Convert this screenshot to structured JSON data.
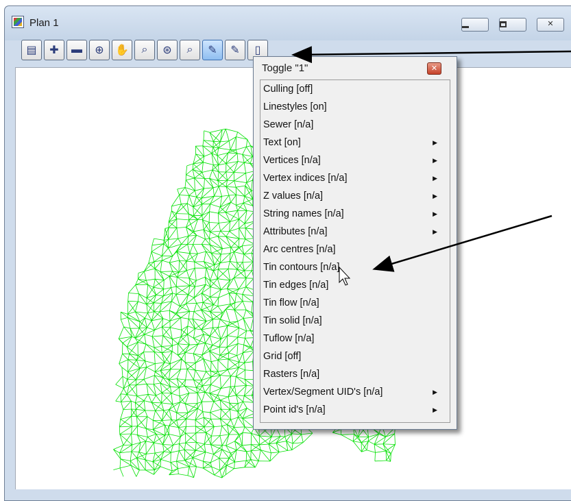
{
  "window": {
    "title": "Plan 1"
  },
  "toolbar": {
    "buttons": [
      {
        "icon": "save-plot-icon"
      },
      {
        "icon": "zoom-in-plus-icon"
      },
      {
        "icon": "zoom-out-minus-icon"
      },
      {
        "icon": "zoom-extent-icon"
      },
      {
        "icon": "pan-hand-icon"
      },
      {
        "icon": "zoom-region-icon"
      },
      {
        "icon": "zoom-reset-icon"
      },
      {
        "icon": "zoom-window-icon"
      },
      {
        "icon": "toggle-icon"
      },
      {
        "icon": "tool-icon"
      },
      {
        "icon": "document-icon"
      }
    ]
  },
  "menu": {
    "title": "Toggle \"1\"",
    "items": [
      {
        "label": "Culling [off]",
        "submenu": false
      },
      {
        "label": "Linestyles [on]",
        "submenu": false
      },
      {
        "label": "Sewer [n/a]",
        "submenu": false
      },
      {
        "label": "Text [on]",
        "submenu": true
      },
      {
        "label": "Vertices [n/a]",
        "submenu": true
      },
      {
        "label": "Vertex indices [n/a]",
        "submenu": true
      },
      {
        "label": "Z values [n/a]",
        "submenu": true
      },
      {
        "label": "String names [n/a]",
        "submenu": true
      },
      {
        "label": "Attributes [n/a]",
        "submenu": true
      },
      {
        "label": "Arc centres [n/a]",
        "submenu": false
      },
      {
        "label": "Tin contours [n/a]",
        "submenu": false
      },
      {
        "label": "Tin edges [n/a]",
        "submenu": false
      },
      {
        "label": "Tin flow [n/a]",
        "submenu": false
      },
      {
        "label": "Tin solid [n/a]",
        "submenu": false
      },
      {
        "label": "Tuflow [n/a]",
        "submenu": false
      },
      {
        "label": "Grid [off]",
        "submenu": false
      },
      {
        "label": "Rasters [n/a]",
        "submenu": false
      },
      {
        "label": "Vertex/Segment UID's [n/a]",
        "submenu": true
      },
      {
        "label": "Point id's [n/a]",
        "submenu": true
      }
    ]
  },
  "colors": {
    "mesh": "#00e000",
    "window_frame": "#cfdcec"
  }
}
